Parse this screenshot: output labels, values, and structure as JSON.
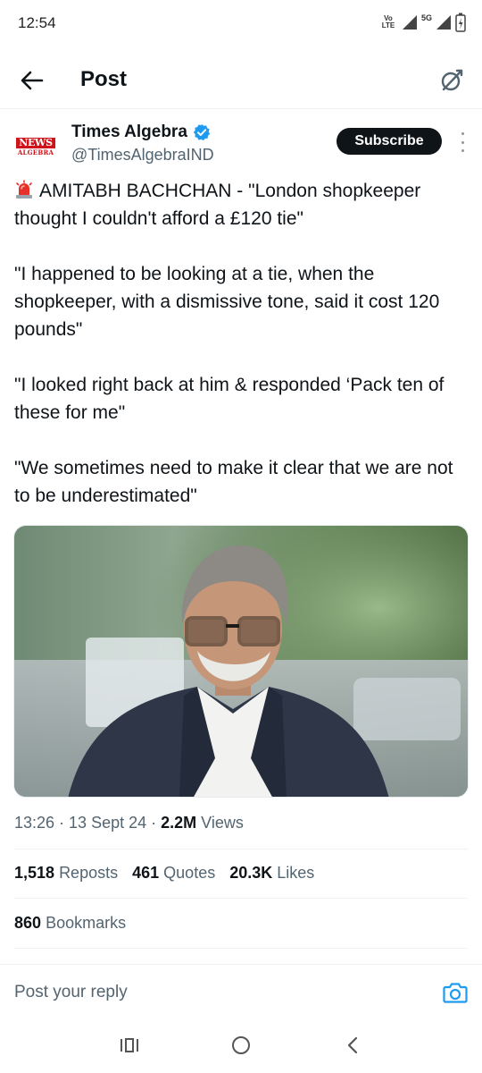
{
  "status_bar": {
    "time": "12:54",
    "volte": "Vo LTE",
    "network": "5G"
  },
  "header": {
    "title": "Post",
    "icons": {
      "back": "arrow-left-icon",
      "grok": "grok-icon"
    }
  },
  "author": {
    "name": "Times Algebra",
    "handle": "@TimesAlgebraIND",
    "avatar_line1": "NEWS",
    "avatar_line2": "ALGEBRA",
    "verified": true,
    "subscribe_label": "Subscribe"
  },
  "post": {
    "paragraphs": [
      "AMITABH BACHCHAN - \"London shopkeeper thought I couldn't afford a £120 tie\"",
      "\"I happened to be looking at a tie, when the shopkeeper, with a dismissive tone, said it cost 120 pounds\"",
      "\"I looked right back at him & responded ‘Pack ten of these for me\"",
      "\"We sometimes need to make it clear that we are not to be underestimated\""
    ],
    "lead_icon": "siren-emoji-icon"
  },
  "meta": {
    "time": "13:26",
    "date": "13 Sept 24",
    "views_count": "2.2M",
    "views_label": "Views"
  },
  "stats": {
    "reposts_count": "1,518",
    "reposts_label": "Reposts",
    "quotes_count": "461",
    "quotes_label": "Quotes",
    "likes_count": "20.3K",
    "likes_label": "Likes",
    "bookmarks_count": "860",
    "bookmarks_label": "Bookmarks"
  },
  "reply": {
    "placeholder": "Post your reply",
    "icon": "camera-icon"
  },
  "colors": {
    "accent": "#1d9bf0",
    "text": "#0f1419",
    "muted": "#536471",
    "brand_red": "#d0121a"
  }
}
